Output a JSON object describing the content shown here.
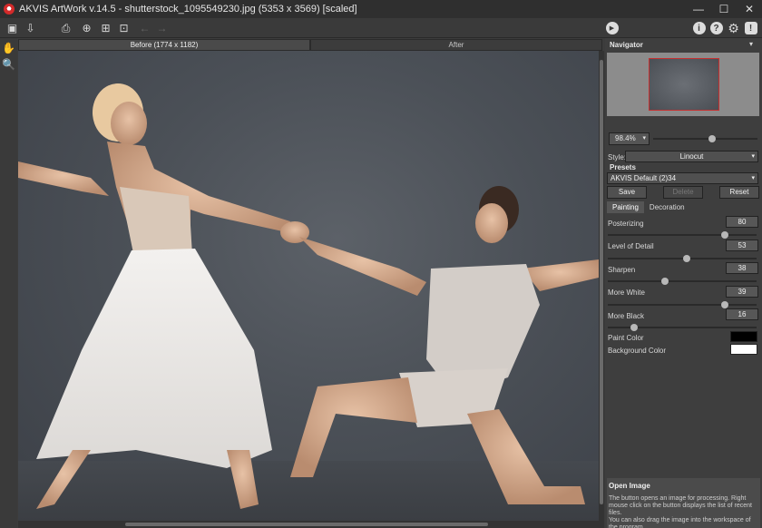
{
  "window": {
    "title": "AKVIS ArtWork v.14.5 - shutterstock_1095549230.jpg (5353 x 3569) [scaled]",
    "controls": {
      "minimize": "—",
      "maximize": "☐",
      "close": "✕"
    }
  },
  "toolbar": {
    "icons": [
      "open-image-icon",
      "save-image-icon",
      "print-icon",
      "share-icon",
      "batch-icon",
      "export-icon",
      "undo-icon",
      "redo-icon",
      "run-icon",
      "info-icon",
      "help-icon",
      "settings-icon",
      "notifications-icon"
    ],
    "glyphs": {
      "open": "▣",
      "save": "⇩",
      "print": "⎙",
      "share": "⊕",
      "batch": "⊞",
      "export": "⊡",
      "undo": "←",
      "redo": "→",
      "run": "▶",
      "info": "i",
      "help": "?",
      "settings": "⚙",
      "notify": "!"
    }
  },
  "left_tools": {
    "hand": "✋",
    "zoom": "🔍"
  },
  "canvas": {
    "tabs": [
      {
        "label": "Before (1774 x 1182)",
        "active": true
      },
      {
        "label": "After",
        "active": false
      }
    ]
  },
  "navigator": {
    "title": "Navigator",
    "collapse": "▾",
    "zoom": "98.4%",
    "zoom_arrow": "▾",
    "zoom_level": 0.55
  },
  "style": {
    "label": "Style:",
    "value": "Linocut",
    "arrow": "▾"
  },
  "presets": {
    "title": "Presets",
    "value": "AKVIS Default (2)34",
    "arrow": "▾",
    "buttons": {
      "save": "Save",
      "delete": "Delete",
      "reset": "Reset"
    }
  },
  "param_tabs": [
    {
      "label": "Painting",
      "active": true
    },
    {
      "label": "Decoration",
      "active": false
    }
  ],
  "params": [
    {
      "label": "Posterizing",
      "value": "80",
      "level": 0.8
    },
    {
      "label": "Level of Detail",
      "value": "53",
      "level": 0.53
    },
    {
      "label": "Sharpen",
      "value": "38",
      "level": 0.38
    },
    {
      "label": "More White",
      "value": "39",
      "level": 0.8
    },
    {
      "label": "More Black",
      "value": "16",
      "level": 0.16
    }
  ],
  "colors": {
    "paint_label": "Paint Color",
    "paint": "#000000",
    "background_label": "Background Color",
    "background": "#ffffff"
  },
  "help": {
    "title": "Open Image",
    "text": "The button opens an image for processing. Right mouse click on the button displays the list of recent files.",
    "text2": "You can also drag the image into the workspace of the program."
  }
}
